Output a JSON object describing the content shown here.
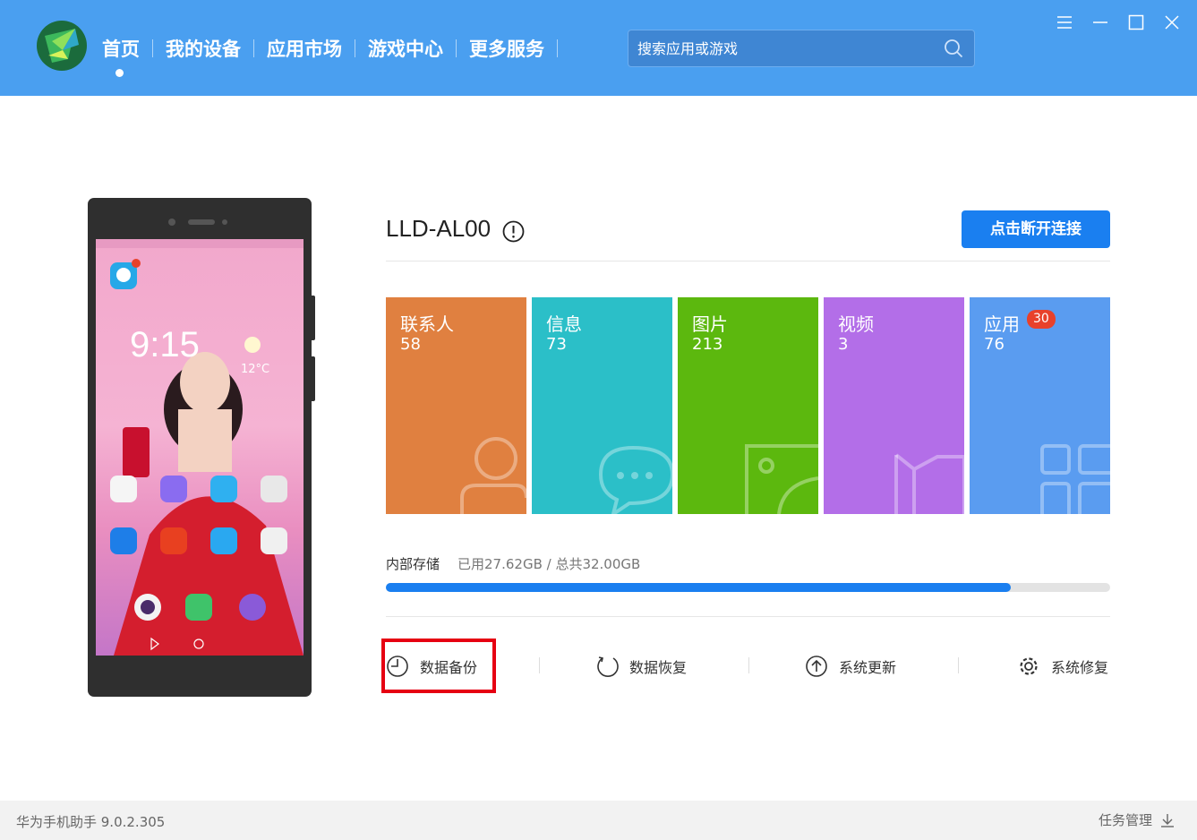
{
  "header": {
    "nav": [
      {
        "label": "首页"
      },
      {
        "label": "我的设备"
      },
      {
        "label": "应用市场"
      },
      {
        "label": "游戏中心"
      },
      {
        "label": "更多服务"
      }
    ],
    "search_placeholder": "搜索应用或游戏",
    "colors": {
      "bar": "#4a9ff0",
      "accent": "#1a7ff0"
    }
  },
  "device": {
    "name": "LLD-AL00",
    "disconnect_label": "点击断开连接"
  },
  "phone_screen": {
    "time": "9:15",
    "temperature": "12°C"
  },
  "tiles": [
    {
      "label": "联系人",
      "count": "58",
      "color": "#e08040",
      "icon": "person-icon"
    },
    {
      "label": "信息",
      "count": "73",
      "color": "#2bbfc8",
      "icon": "chat-icon"
    },
    {
      "label": "图片",
      "count": "213",
      "color": "#5cb80e",
      "icon": "image-icon"
    },
    {
      "label": "视频",
      "count": "3",
      "color": "#b36ee8",
      "icon": "video-icon"
    },
    {
      "label": "应用",
      "count": "76",
      "badge": "30",
      "color": "#5a9cf0",
      "icon": "apps-icon"
    }
  ],
  "storage": {
    "label": "内部存储",
    "value": "已用27.62GB / 总共32.00GB",
    "used_fraction": 0.863
  },
  "actions": [
    {
      "label": "数据备份",
      "icon": "backup-clock-icon"
    },
    {
      "label": "数据恢复",
      "icon": "restore-icon"
    },
    {
      "label": "系统更新",
      "icon": "update-arrow-icon"
    },
    {
      "label": "系统修复",
      "icon": "gear-icon"
    }
  ],
  "status": {
    "version": "华为手机助手 9.0.2.305",
    "task_manager": "任务管理"
  }
}
